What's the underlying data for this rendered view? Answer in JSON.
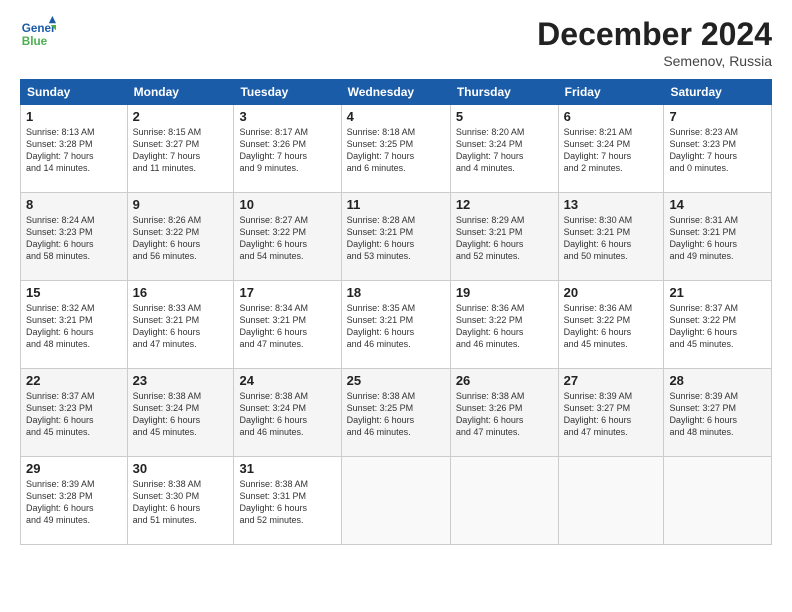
{
  "header": {
    "logo": {
      "line1": "General",
      "line2": "Blue"
    },
    "title": "December 2024",
    "subtitle": "Semenov, Russia"
  },
  "weekdays": [
    "Sunday",
    "Monday",
    "Tuesday",
    "Wednesday",
    "Thursday",
    "Friday",
    "Saturday"
  ],
  "weeks": [
    [
      {
        "day": "1",
        "info": "Sunrise: 8:13 AM\nSunset: 3:28 PM\nDaylight: 7 hours\nand 14 minutes."
      },
      {
        "day": "2",
        "info": "Sunrise: 8:15 AM\nSunset: 3:27 PM\nDaylight: 7 hours\nand 11 minutes."
      },
      {
        "day": "3",
        "info": "Sunrise: 8:17 AM\nSunset: 3:26 PM\nDaylight: 7 hours\nand 9 minutes."
      },
      {
        "day": "4",
        "info": "Sunrise: 8:18 AM\nSunset: 3:25 PM\nDaylight: 7 hours\nand 6 minutes."
      },
      {
        "day": "5",
        "info": "Sunrise: 8:20 AM\nSunset: 3:24 PM\nDaylight: 7 hours\nand 4 minutes."
      },
      {
        "day": "6",
        "info": "Sunrise: 8:21 AM\nSunset: 3:24 PM\nDaylight: 7 hours\nand 2 minutes."
      },
      {
        "day": "7",
        "info": "Sunrise: 8:23 AM\nSunset: 3:23 PM\nDaylight: 7 hours\nand 0 minutes."
      }
    ],
    [
      {
        "day": "8",
        "info": "Sunrise: 8:24 AM\nSunset: 3:23 PM\nDaylight: 6 hours\nand 58 minutes."
      },
      {
        "day": "9",
        "info": "Sunrise: 8:26 AM\nSunset: 3:22 PM\nDaylight: 6 hours\nand 56 minutes."
      },
      {
        "day": "10",
        "info": "Sunrise: 8:27 AM\nSunset: 3:22 PM\nDaylight: 6 hours\nand 54 minutes."
      },
      {
        "day": "11",
        "info": "Sunrise: 8:28 AM\nSunset: 3:21 PM\nDaylight: 6 hours\nand 53 minutes."
      },
      {
        "day": "12",
        "info": "Sunrise: 8:29 AM\nSunset: 3:21 PM\nDaylight: 6 hours\nand 52 minutes."
      },
      {
        "day": "13",
        "info": "Sunrise: 8:30 AM\nSunset: 3:21 PM\nDaylight: 6 hours\nand 50 minutes."
      },
      {
        "day": "14",
        "info": "Sunrise: 8:31 AM\nSunset: 3:21 PM\nDaylight: 6 hours\nand 49 minutes."
      }
    ],
    [
      {
        "day": "15",
        "info": "Sunrise: 8:32 AM\nSunset: 3:21 PM\nDaylight: 6 hours\nand 48 minutes."
      },
      {
        "day": "16",
        "info": "Sunrise: 8:33 AM\nSunset: 3:21 PM\nDaylight: 6 hours\nand 47 minutes."
      },
      {
        "day": "17",
        "info": "Sunrise: 8:34 AM\nSunset: 3:21 PM\nDaylight: 6 hours\nand 47 minutes."
      },
      {
        "day": "18",
        "info": "Sunrise: 8:35 AM\nSunset: 3:21 PM\nDaylight: 6 hours\nand 46 minutes."
      },
      {
        "day": "19",
        "info": "Sunrise: 8:36 AM\nSunset: 3:22 PM\nDaylight: 6 hours\nand 46 minutes."
      },
      {
        "day": "20",
        "info": "Sunrise: 8:36 AM\nSunset: 3:22 PM\nDaylight: 6 hours\nand 45 minutes."
      },
      {
        "day": "21",
        "info": "Sunrise: 8:37 AM\nSunset: 3:22 PM\nDaylight: 6 hours\nand 45 minutes."
      }
    ],
    [
      {
        "day": "22",
        "info": "Sunrise: 8:37 AM\nSunset: 3:23 PM\nDaylight: 6 hours\nand 45 minutes."
      },
      {
        "day": "23",
        "info": "Sunrise: 8:38 AM\nSunset: 3:24 PM\nDaylight: 6 hours\nand 45 minutes."
      },
      {
        "day": "24",
        "info": "Sunrise: 8:38 AM\nSunset: 3:24 PM\nDaylight: 6 hours\nand 46 minutes."
      },
      {
        "day": "25",
        "info": "Sunrise: 8:38 AM\nSunset: 3:25 PM\nDaylight: 6 hours\nand 46 minutes."
      },
      {
        "day": "26",
        "info": "Sunrise: 8:38 AM\nSunset: 3:26 PM\nDaylight: 6 hours\nand 47 minutes."
      },
      {
        "day": "27",
        "info": "Sunrise: 8:39 AM\nSunset: 3:27 PM\nDaylight: 6 hours\nand 47 minutes."
      },
      {
        "day": "28",
        "info": "Sunrise: 8:39 AM\nSunset: 3:27 PM\nDaylight: 6 hours\nand 48 minutes."
      }
    ],
    [
      {
        "day": "29",
        "info": "Sunrise: 8:39 AM\nSunset: 3:28 PM\nDaylight: 6 hours\nand 49 minutes."
      },
      {
        "day": "30",
        "info": "Sunrise: 8:38 AM\nSunset: 3:30 PM\nDaylight: 6 hours\nand 51 minutes."
      },
      {
        "day": "31",
        "info": "Sunrise: 8:38 AM\nSunset: 3:31 PM\nDaylight: 6 hours\nand 52 minutes."
      },
      {
        "day": "",
        "info": ""
      },
      {
        "day": "",
        "info": ""
      },
      {
        "day": "",
        "info": ""
      },
      {
        "day": "",
        "info": ""
      }
    ]
  ]
}
